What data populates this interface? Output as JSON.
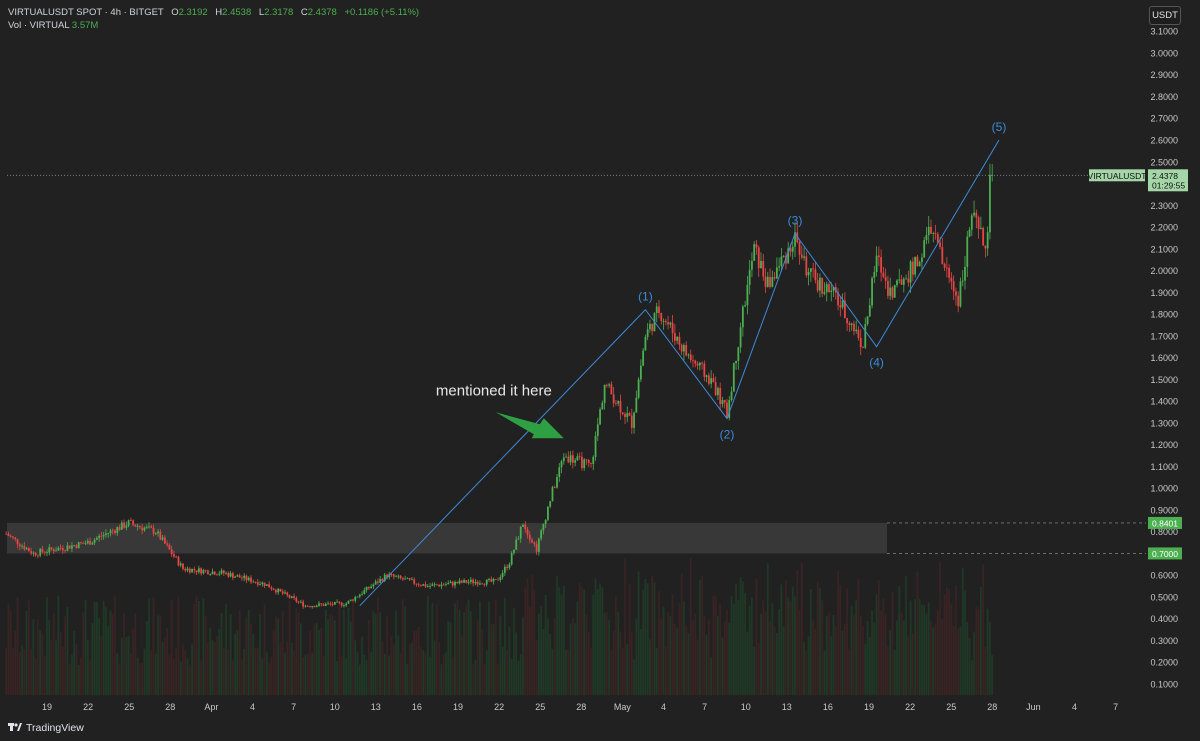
{
  "header": {
    "symbol": "VIRTUALUSDT SPOT · 4h · BITGET",
    "o_label": "O",
    "o_value": "2.3192",
    "h_label": "H",
    "h_value": "2.4538",
    "l_label": "L",
    "l_value": "2.3178",
    "c_label": "C",
    "c_value": "2.4378",
    "change": "+0.1186 (+5.11%)",
    "vol_label": "Vol · VIRTUAL",
    "vol_value": "3.57M"
  },
  "currency_button": "USDT",
  "branding": "TradingView",
  "colors": {
    "up": "#4caf50",
    "down": "#e84545",
    "wave": "#3d8bd9",
    "arrow": "#2ea043",
    "zone": "#3a3a3a",
    "bg": "#212121"
  },
  "chart_data": {
    "type": "candlestick",
    "timeframe": "4h",
    "ylim": [
      0.0,
      3.18
    ],
    "y_ticks": [
      "3.1000",
      "3.0000",
      "2.9000",
      "2.8000",
      "2.7000",
      "2.6000",
      "2.5000",
      "2.4000",
      "2.3000",
      "2.2000",
      "2.1000",
      "2.0000",
      "1.9000",
      "1.8000",
      "1.7000",
      "1.6000",
      "1.5000",
      "1.4000",
      "1.3000",
      "1.2000",
      "1.1000",
      "1.0000",
      "0.9000",
      "0.8000",
      "0.7000",
      "0.6000",
      "0.5000",
      "0.4000",
      "0.3000",
      "0.2000",
      "0.1000"
    ],
    "x_ticks": [
      "19",
      "22",
      "25",
      "28",
      "Apr",
      "4",
      "7",
      "10",
      "13",
      "16",
      "19",
      "22",
      "25",
      "28",
      "May",
      "4",
      "7",
      "10",
      "13",
      "16",
      "19",
      "22",
      "25",
      "28",
      "Jun",
      "4",
      "7"
    ],
    "price_path": [
      {
        "date": "Mar 16",
        "price": 0.79
      },
      {
        "date": "Mar 18",
        "price": 0.7
      },
      {
        "date": "Mar 22",
        "price": 0.75
      },
      {
        "date": "Mar 25",
        "price": 0.84
      },
      {
        "date": "Mar 27",
        "price": 0.8
      },
      {
        "date": "Mar 29",
        "price": 0.63
      },
      {
        "date": "Apr 1",
        "price": 0.61
      },
      {
        "date": "Apr 4",
        "price": 0.56
      },
      {
        "date": "Apr 7",
        "price": 0.46
      },
      {
        "date": "Apr 10",
        "price": 0.47
      },
      {
        "date": "Apr 13",
        "price": 0.6
      },
      {
        "date": "Apr 16",
        "price": 0.55
      },
      {
        "date": "Apr 19",
        "price": 0.57
      },
      {
        "date": "Apr 21",
        "price": 0.57
      },
      {
        "date": "Apr 22",
        "price": 0.66
      },
      {
        "date": "Apr 23",
        "price": 0.84
      },
      {
        "date": "Apr 24",
        "price": 0.72
      },
      {
        "date": "Apr 25",
        "price": 0.95
      },
      {
        "date": "Apr 26",
        "price": 1.15
      },
      {
        "date": "Apr 28",
        "price": 1.1
      },
      {
        "date": "Apr 29",
        "price": 1.48
      },
      {
        "date": "May 1",
        "price": 1.3
      },
      {
        "date": "May 2",
        "price": 1.7
      },
      {
        "date": "May 3",
        "price": 1.82
      },
      {
        "date": "May 5",
        "price": 1.62
      },
      {
        "date": "May 7",
        "price": 1.48
      },
      {
        "date": "May 8",
        "price": 1.34
      },
      {
        "date": "May 9",
        "price": 1.75
      },
      {
        "date": "May 10",
        "price": 2.1
      },
      {
        "date": "May 11",
        "price": 1.93
      },
      {
        "date": "May 13",
        "price": 2.15
      },
      {
        "date": "May 14",
        "price": 1.98
      },
      {
        "date": "May 16",
        "price": 1.88
      },
      {
        "date": "May 18",
        "price": 1.66
      },
      {
        "date": "May 19",
        "price": 2.06
      },
      {
        "date": "May 20",
        "price": 1.9
      },
      {
        "date": "May 22",
        "price": 2.03
      },
      {
        "date": "May 23",
        "price": 2.2
      },
      {
        "date": "May 24",
        "price": 2.01
      },
      {
        "date": "May 25",
        "price": 1.87
      },
      {
        "date": "May 26",
        "price": 2.25
      },
      {
        "date": "May 27",
        "price": 2.1
      },
      {
        "date": "May 27",
        "price": 2.44
      }
    ],
    "last_price": {
      "symbol": "VIRTUALUSDT",
      "value": "2.4378",
      "countdown": "01:29:55"
    },
    "zone": {
      "upper": 0.8401,
      "lower": 0.7,
      "upper_label": "0.8401",
      "lower_label": "0.7000"
    },
    "wave_points": [
      {
        "label": "",
        "date": "Apr 11",
        "price": 0.46
      },
      {
        "label": "(1)",
        "date": "May 2",
        "price": 1.82
      },
      {
        "label": "(2)",
        "date": "May 8",
        "price": 1.32
      },
      {
        "label": "(3)",
        "date": "May 13",
        "price": 2.17
      },
      {
        "label": "(4)",
        "date": "May 19",
        "price": 1.65
      },
      {
        "label": "(5)",
        "date": "May 28",
        "price": 2.6
      }
    ],
    "annotation": {
      "text": "mentioned it here",
      "points_to": {
        "date": "Apr 26",
        "price": 1.22
      }
    }
  }
}
